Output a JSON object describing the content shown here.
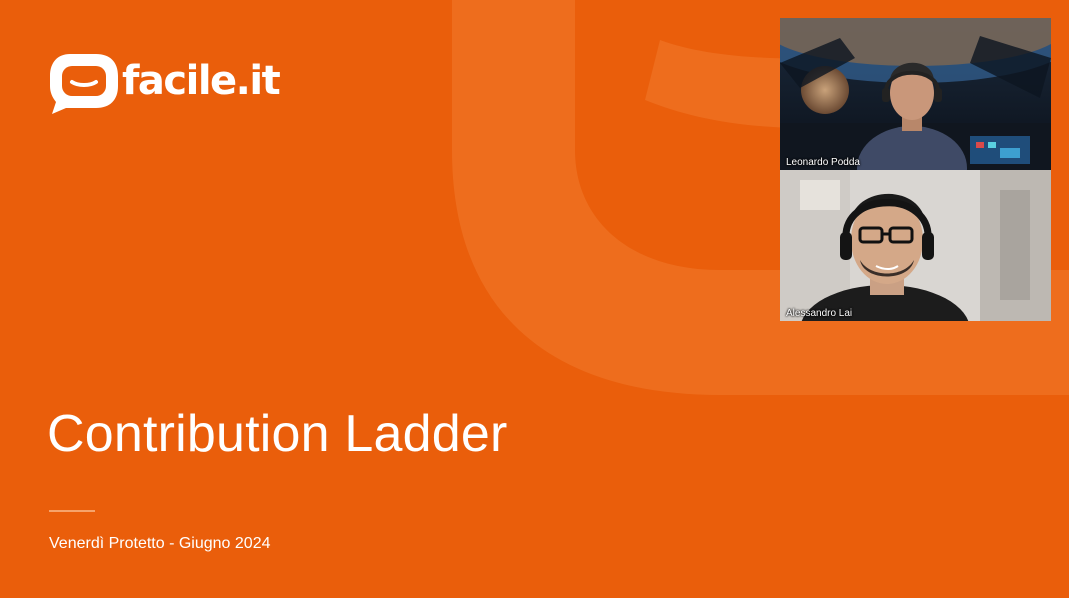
{
  "brand": {
    "logo_text": "facile.it",
    "colors": {
      "background": "#EA5E0B",
      "text": "#FFFFFF",
      "accent_line": "#F6A36B"
    }
  },
  "slide": {
    "title": "Contribution Ladder",
    "subtitle": "Venerdì Protetto - Giugno 2024"
  },
  "participants": [
    {
      "name": "Leonardo Podda"
    },
    {
      "name": "Alessandro Lai"
    }
  ]
}
